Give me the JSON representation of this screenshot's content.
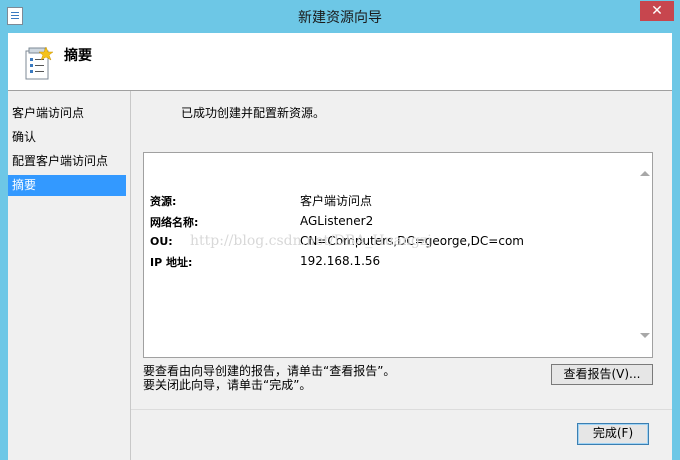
{
  "window": {
    "title": "新建资源向导",
    "close_glyph": "✕",
    "app_icon": "wizard-document-icon"
  },
  "header": {
    "title": "摘要",
    "icon": "summary-checklist-icon"
  },
  "nav": {
    "items": [
      {
        "label": "客户端访问点"
      },
      {
        "label": "确认"
      },
      {
        "label": "配置客户端访问点"
      },
      {
        "label": "摘要"
      }
    ],
    "active_index": 3
  },
  "main": {
    "success_message": "已成功创建并配置新资源。",
    "details": {
      "resource_label": "资源:",
      "resource_value": "客户端访问点",
      "network_name_label": "网络名称:",
      "network_name_value": "AGListener2",
      "ou_label": "OU:",
      "ou_value": "CN=Computers,DC=george,DC=com",
      "ip_label": "IP 地址:",
      "ip_value": "192.168.1.56"
    },
    "watermark": "http://blog.csdn.net/DBA_Huangzj",
    "hint_view_report": "要查看由向导创建的报告，请单击“查看报告”。",
    "hint_close": "要关闭此向导，请单击“完成”。",
    "view_report_button": "查看报告(V)...",
    "finish_button": "完成(F)"
  },
  "colors": {
    "titlebar": "#6dc7e6",
    "close_button": "#c7464e",
    "selection": "#3399ff"
  }
}
